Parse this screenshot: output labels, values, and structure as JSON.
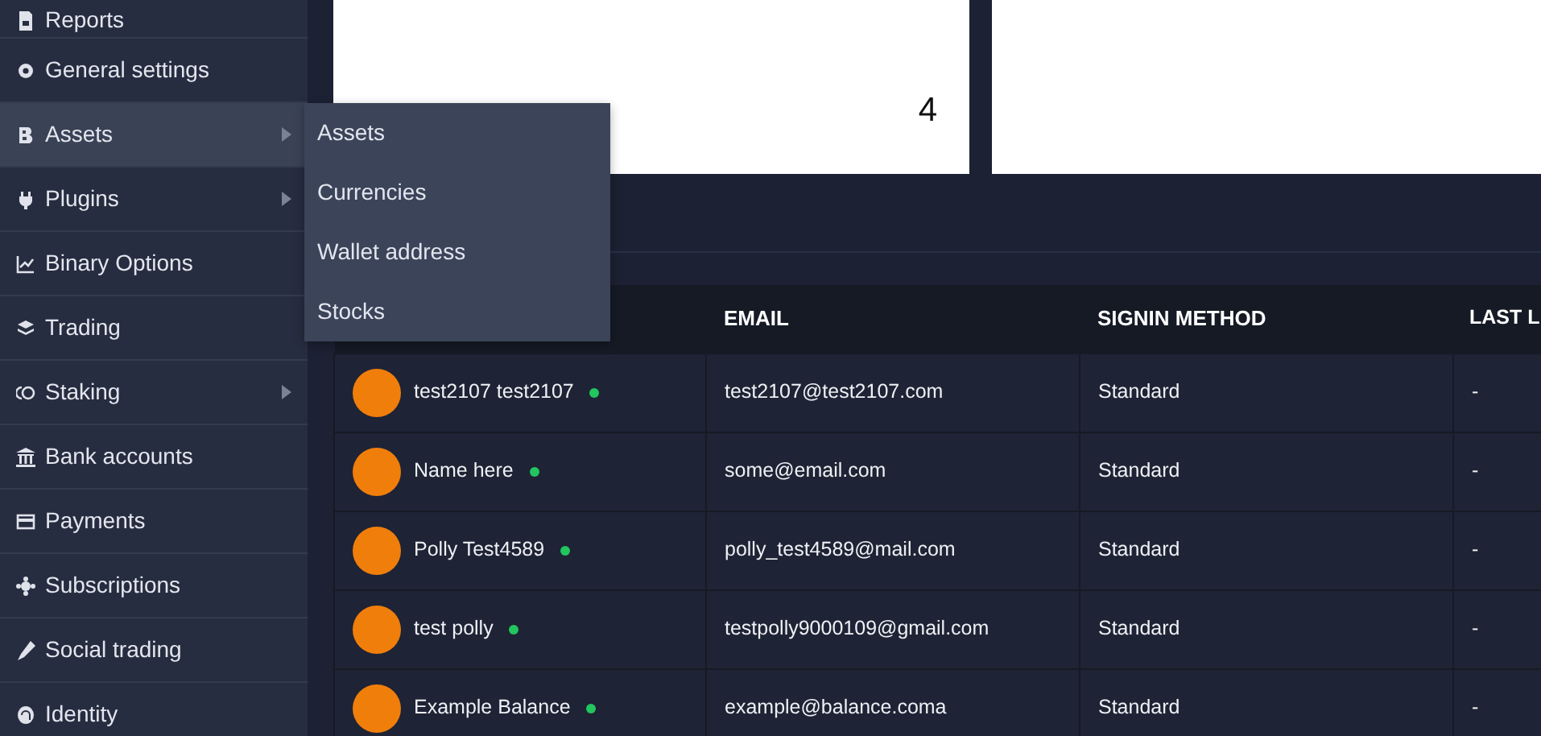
{
  "sidebar": {
    "items": [
      {
        "label": "Reports",
        "has_submenu": false,
        "selected": false
      },
      {
        "label": "General settings",
        "has_submenu": false,
        "selected": false
      },
      {
        "label": "Assets",
        "has_submenu": true,
        "selected": true
      },
      {
        "label": "Plugins",
        "has_submenu": true,
        "selected": false
      },
      {
        "label": "Binary Options",
        "has_submenu": false,
        "selected": false
      },
      {
        "label": "Trading",
        "has_submenu": false,
        "selected": false
      },
      {
        "label": "Staking",
        "has_submenu": true,
        "selected": false
      },
      {
        "label": "Bank accounts",
        "has_submenu": false,
        "selected": false
      },
      {
        "label": "Payments",
        "has_submenu": false,
        "selected": false
      },
      {
        "label": "Subscriptions",
        "has_submenu": false,
        "selected": false
      },
      {
        "label": "Social trading",
        "has_submenu": false,
        "selected": false
      },
      {
        "label": "Identity",
        "has_submenu": false,
        "selected": false
      }
    ]
  },
  "submenu": {
    "items": [
      "Assets",
      "Currencies",
      "Wallet address",
      "Stocks"
    ]
  },
  "stat_card": {
    "value": "4"
  },
  "table": {
    "columns": [
      "EMAIL",
      "SIGNIN METHOD",
      "LAST L"
    ],
    "rows": [
      {
        "name": "test2107 test2107",
        "color": "#22c55e",
        "email": "test2107@test2107.com",
        "signin": "Standard",
        "last": "-"
      },
      {
        "name": "Name here",
        "color": "#22c55e",
        "email": "some@email.com",
        "signin": "Standard",
        "last": "-"
      },
      {
        "name": "Polly Test4589",
        "color": "#22c55e",
        "email": "polly_test4589@mail.com",
        "signin": "Standard",
        "last": "-"
      },
      {
        "name": "test polly",
        "color": "#22c55e",
        "email": "testpolly9000109@gmail.com",
        "signin": "Standard",
        "last": "-"
      },
      {
        "name": "Example Balance",
        "color": "#22c55e",
        "email": "example@balance.coma",
        "signin": "Standard",
        "last": "-"
      }
    ]
  }
}
